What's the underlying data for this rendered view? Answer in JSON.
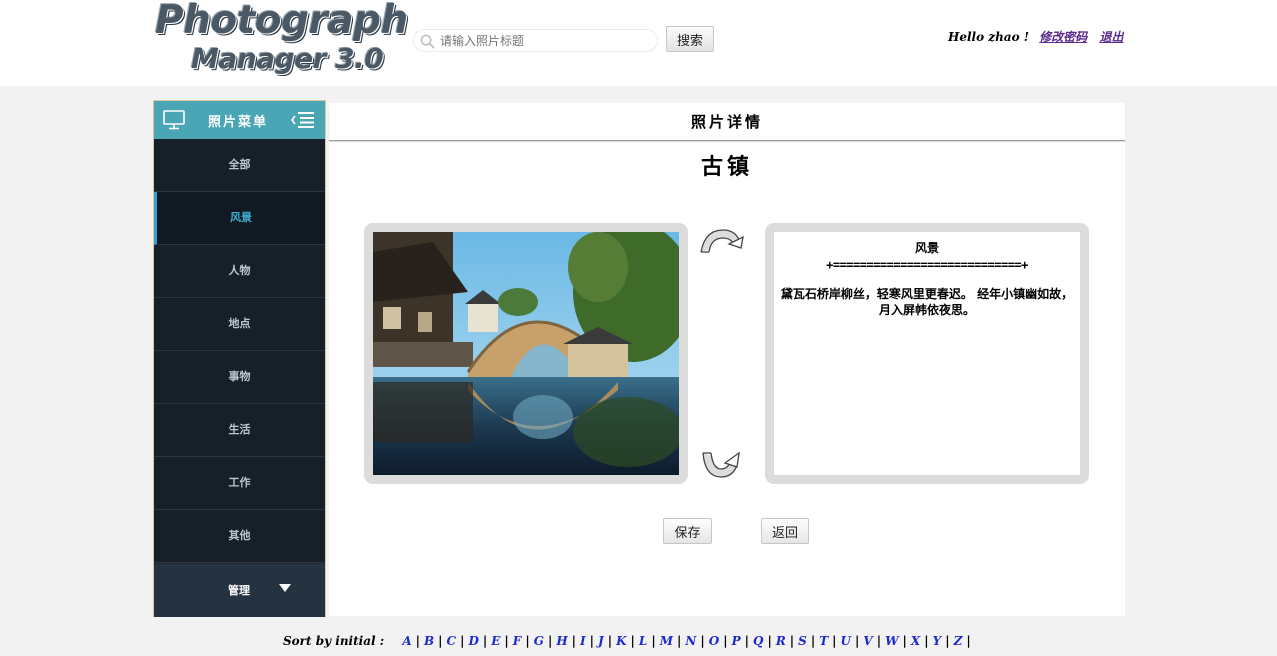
{
  "header": {
    "logo_line1": "Photograph",
    "logo_line2": "Manager 3.0",
    "search_placeholder": "请输入照片标题",
    "search_button": "搜索",
    "greeting": "Hello zhao !",
    "change_password": "修改密码",
    "logout": "退出"
  },
  "sidebar": {
    "title": "照片菜单",
    "items": [
      {
        "label": "全部"
      },
      {
        "label": "风景"
      },
      {
        "label": "人物"
      },
      {
        "label": "地点"
      },
      {
        "label": "事物"
      },
      {
        "label": "生活"
      },
      {
        "label": "工作"
      },
      {
        "label": "其他"
      }
    ],
    "active_index": 1,
    "manage_label": "管理"
  },
  "main": {
    "panel_title": "照片详情",
    "photo_title": "古镇",
    "description": {
      "category": "风景",
      "separator": "+============================+",
      "text": "黛瓦石桥岸柳丝，轻寒风里更春迟。 经年小镇幽如故，月入屏帏依夜思。"
    },
    "save_button": "保存",
    "back_button": "返回"
  },
  "footer": {
    "label": "Sort by initial :",
    "letters": [
      "A",
      "B",
      "C",
      "D",
      "E",
      "F",
      "G",
      "H",
      "I",
      "J",
      "K",
      "L",
      "M",
      "N",
      "O",
      "P",
      "Q",
      "R",
      "S",
      "T",
      "U",
      "V",
      "W",
      "X",
      "Y",
      "Z"
    ]
  },
  "colors": {
    "sidebar_bg": "#1f2a34",
    "sidebar_header": "#4aa5b5",
    "active_accent": "#3a9ed0",
    "link_purple": "#5a2a8c",
    "letter_blue": "#1a2ad0"
  }
}
